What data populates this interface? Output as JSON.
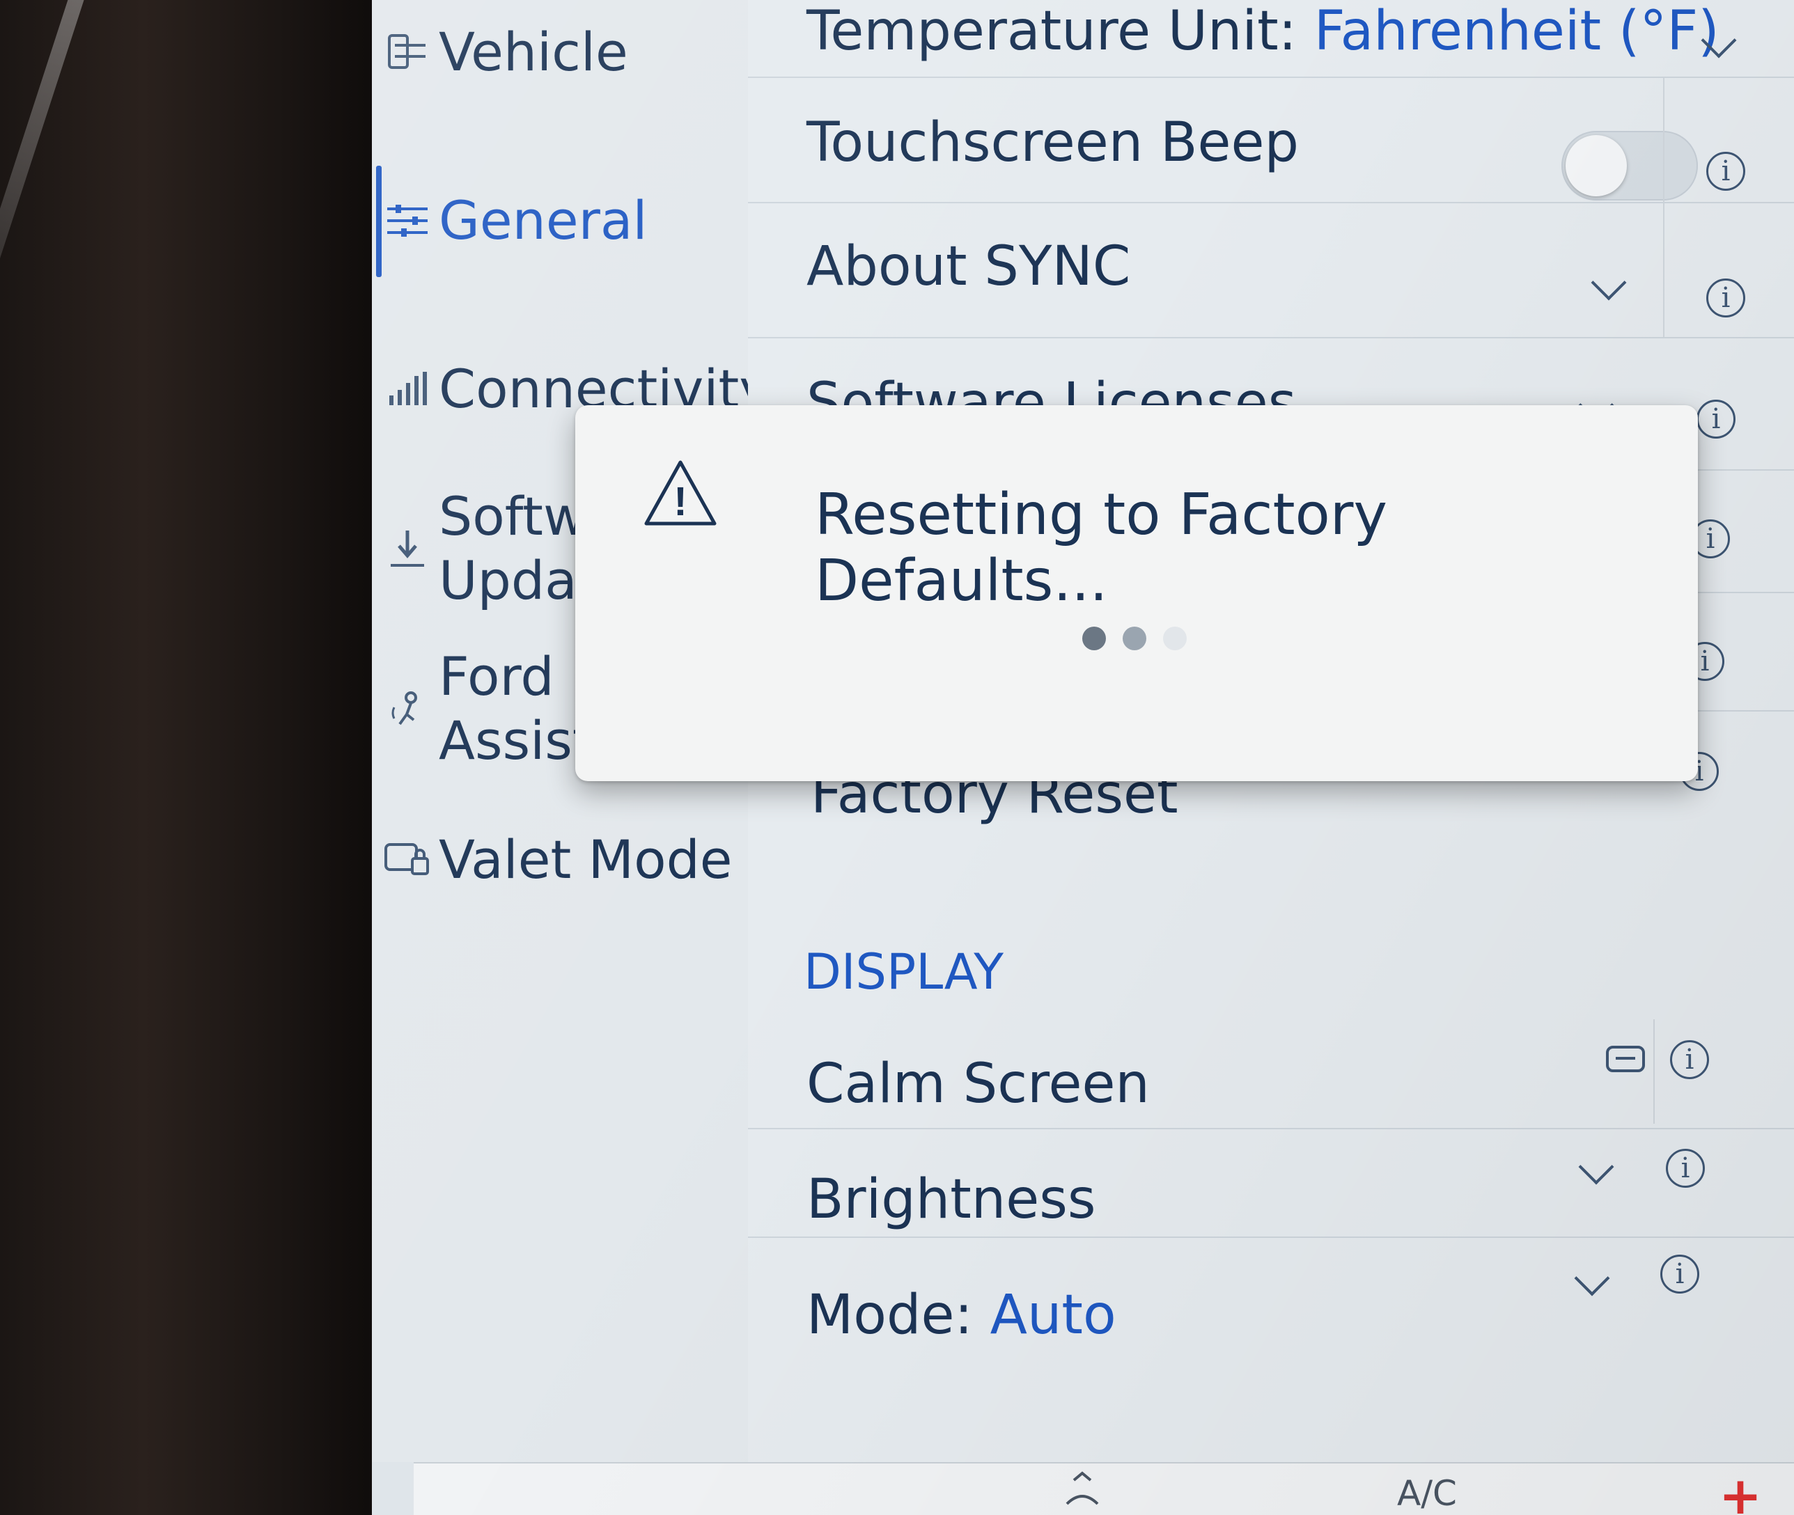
{
  "sidebar": {
    "items": [
      {
        "label": "Vehicle",
        "icon": "vehicle-settings-icon"
      },
      {
        "label": "General",
        "icon": "sliders-icon",
        "active": true
      },
      {
        "label": "Connectivity",
        "icon": "signal-bars-icon"
      },
      {
        "label_line1": "Softw",
        "label_line2": "Upda",
        "icon": "download-icon"
      },
      {
        "label_line1": "Ford",
        "label_line2": "Assist",
        "icon": "ford-assist-icon"
      },
      {
        "label": "Valet Mode",
        "icon": "valet-lock-icon"
      }
    ]
  },
  "settings": {
    "temperature": {
      "label": "Temperature Unit:",
      "value": "Fahrenheit (°F)"
    },
    "touchscreen_beep": {
      "label": "Touchscreen Beep",
      "enabled": false
    },
    "about_sync": {
      "label": "About SYNC"
    },
    "software_licenses": {
      "label": "Software Licenses"
    },
    "factory_reset": {
      "label": "Factory Reset"
    },
    "display_section": "DISPLAY",
    "calm_screen": {
      "label": "Calm Screen"
    },
    "brightness": {
      "label": "Brightness"
    },
    "mode": {
      "label": "Mode:",
      "value": "Auto"
    },
    "info_glyph": "i"
  },
  "modal": {
    "message": "Resetting to Factory Defaults...",
    "warning_glyph": "!",
    "icon": "warning-triangle-icon",
    "dots": [
      "#6b7784",
      "#9aa5b0",
      "#e2e6ea"
    ]
  },
  "climate": {
    "ac_label": "A/C",
    "plus_label": "+"
  },
  "colors": {
    "accent": "#1f58c2",
    "text": "#1b3354",
    "danger": "#e03131"
  }
}
